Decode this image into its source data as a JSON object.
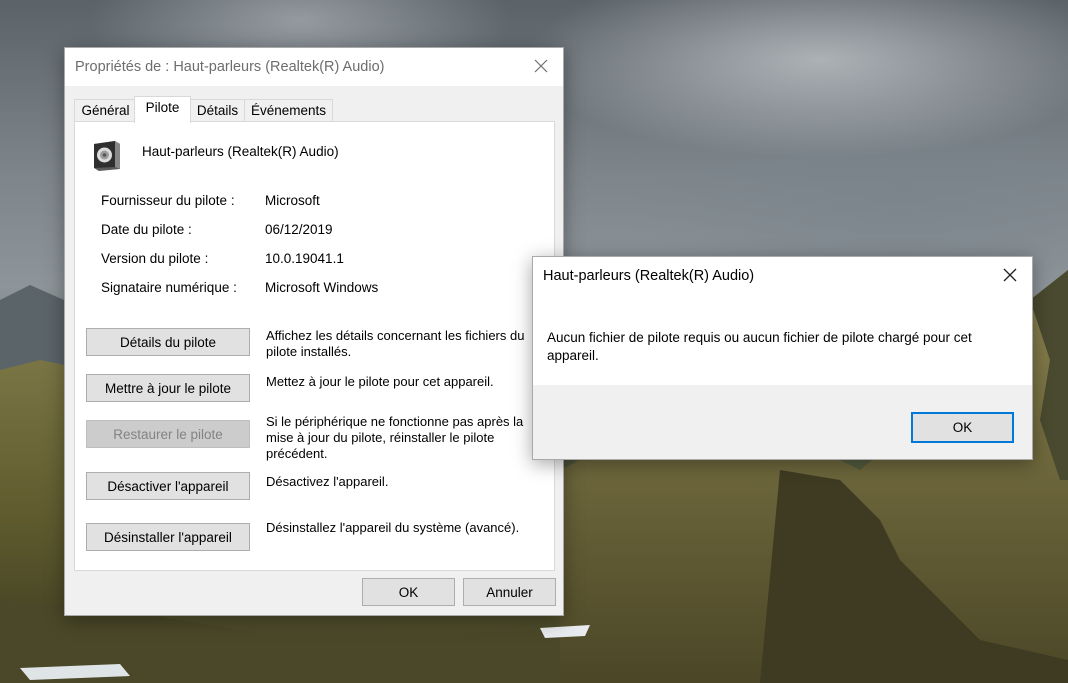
{
  "properties_window": {
    "title": "Propriétés de : Haut-parleurs (Realtek(R) Audio)",
    "tabs": [
      {
        "label": "Général"
      },
      {
        "label": "Pilote"
      },
      {
        "label": "Détails"
      },
      {
        "label": "Événements"
      }
    ],
    "active_tab": "Pilote",
    "device_name": "Haut-parleurs (Realtek(R) Audio)",
    "info": [
      {
        "label": "Fournisseur du pilote :",
        "value": "Microsoft"
      },
      {
        "label": "Date du pilote :",
        "value": "06/12/2019"
      },
      {
        "label": "Version du pilote :",
        "value": "10.0.19041.1"
      },
      {
        "label": "Signataire numérique :",
        "value": "Microsoft Windows"
      }
    ],
    "actions": [
      {
        "button": "Détails du pilote",
        "description": "Affichez les détails concernant les fichiers du pilote installés.",
        "enabled": true
      },
      {
        "button": "Mettre à jour le pilote",
        "description": "Mettez à jour le pilote pour cet appareil.",
        "enabled": true
      },
      {
        "button": "Restaurer le pilote",
        "description": "Si le périphérique ne fonctionne pas après la mise à jour du pilote, réinstaller le pilote précédent.",
        "enabled": false
      },
      {
        "button": "Désactiver l'appareil",
        "description": "Désactivez l'appareil.",
        "enabled": true
      },
      {
        "button": "Désinstaller l'appareil",
        "description": "Désinstallez l'appareil du système (avancé).",
        "enabled": true
      }
    ],
    "ok_label": "OK",
    "cancel_label": "Annuler"
  },
  "message_box": {
    "title": "Haut-parleurs (Realtek(R) Audio)",
    "text": "Aucun fichier de pilote requis ou aucun fichier de pilote chargé pour cet appareil.",
    "ok_label": "OK",
    "accent_color": "#0078d7"
  },
  "icons": {
    "close": "close-icon",
    "device": "speaker-icon"
  }
}
